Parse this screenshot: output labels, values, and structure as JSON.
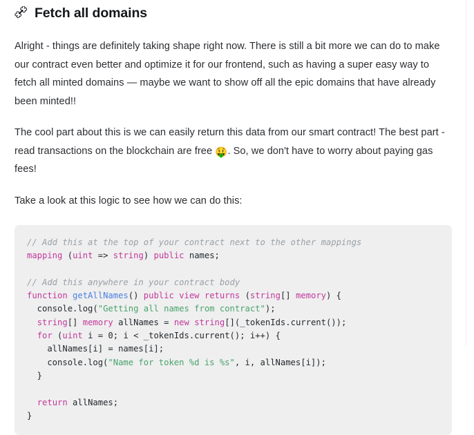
{
  "heading": {
    "icon": "bone-icon",
    "text": "Fetch all domains"
  },
  "paragraphs": {
    "p1": "Alright - things are definitely taking shape right now. There is still a bit more we can do to make our contract even better and optimize it for our frontend, such as having a super easy way to fetch all minted domains — maybe we want to show off all the epic domains that have already been minted!!",
    "p2_before_emoji": "The cool part about this is we can easily return this data from our smart contract! The best part - read transactions on the blockchain are free ",
    "p2_emoji": "🤑",
    "p2_after_emoji": ". So, we don't have to worry about paying gas fees!",
    "p3": "Take a look at this logic to see how we can do this:"
  },
  "code_block": {
    "language": "solidity",
    "background": "#efefef",
    "colors": {
      "comment": "#9aa0a6",
      "keyword": "#c2389c",
      "function": "#4a7fe0",
      "string": "#49a36b",
      "plain": "#24292e"
    },
    "lines": [
      [
        {
          "t": "// Add this at the top of your contract next to the other mappings",
          "c": "comment"
        }
      ],
      [
        {
          "t": "mapping",
          "c": "keyword"
        },
        {
          "t": " (",
          "c": "plain"
        },
        {
          "t": "uint",
          "c": "keyword"
        },
        {
          "t": " => ",
          "c": "plain"
        },
        {
          "t": "string",
          "c": "keyword"
        },
        {
          "t": ") ",
          "c": "plain"
        },
        {
          "t": "public",
          "c": "keyword"
        },
        {
          "t": " names;",
          "c": "plain"
        }
      ],
      [
        {
          "t": "",
          "c": "plain"
        }
      ],
      [
        {
          "t": "// Add this anywhere in your contract body",
          "c": "comment"
        }
      ],
      [
        {
          "t": "function",
          "c": "keyword"
        },
        {
          "t": " ",
          "c": "plain"
        },
        {
          "t": "getAllNames",
          "c": "function"
        },
        {
          "t": "() ",
          "c": "plain"
        },
        {
          "t": "public",
          "c": "keyword"
        },
        {
          "t": " ",
          "c": "plain"
        },
        {
          "t": "view",
          "c": "keyword"
        },
        {
          "t": " ",
          "c": "plain"
        },
        {
          "t": "returns",
          "c": "keyword"
        },
        {
          "t": " (",
          "c": "plain"
        },
        {
          "t": "string",
          "c": "keyword"
        },
        {
          "t": "[] ",
          "c": "plain"
        },
        {
          "t": "memory",
          "c": "keyword"
        },
        {
          "t": ") {",
          "c": "plain"
        }
      ],
      [
        {
          "t": "  console.log(",
          "c": "plain"
        },
        {
          "t": "\"Getting all names from contract\"",
          "c": "string"
        },
        {
          "t": ");",
          "c": "plain"
        }
      ],
      [
        {
          "t": "  ",
          "c": "plain"
        },
        {
          "t": "string",
          "c": "keyword"
        },
        {
          "t": "[] ",
          "c": "plain"
        },
        {
          "t": "memory",
          "c": "keyword"
        },
        {
          "t": " allNames = ",
          "c": "plain"
        },
        {
          "t": "new",
          "c": "keyword"
        },
        {
          "t": " ",
          "c": "plain"
        },
        {
          "t": "string",
          "c": "keyword"
        },
        {
          "t": "[](_tokenIds.current());",
          "c": "plain"
        }
      ],
      [
        {
          "t": "  ",
          "c": "plain"
        },
        {
          "t": "for",
          "c": "keyword"
        },
        {
          "t": " (",
          "c": "plain"
        },
        {
          "t": "uint",
          "c": "keyword"
        },
        {
          "t": " i = 0; i < _tokenIds.current(); i++) {",
          "c": "plain"
        }
      ],
      [
        {
          "t": "    allNames[i] = names[i];",
          "c": "plain"
        }
      ],
      [
        {
          "t": "    console.log(",
          "c": "plain"
        },
        {
          "t": "\"Name for token %d is %s\"",
          "c": "string"
        },
        {
          "t": ", i, allNames[i]);",
          "c": "plain"
        }
      ],
      [
        {
          "t": "  }",
          "c": "plain"
        }
      ],
      [
        {
          "t": "",
          "c": "plain"
        }
      ],
      [
        {
          "t": "  ",
          "c": "plain"
        },
        {
          "t": "return",
          "c": "keyword"
        },
        {
          "t": " allNames;",
          "c": "plain"
        }
      ],
      [
        {
          "t": "}",
          "c": "plain"
        }
      ]
    ]
  }
}
